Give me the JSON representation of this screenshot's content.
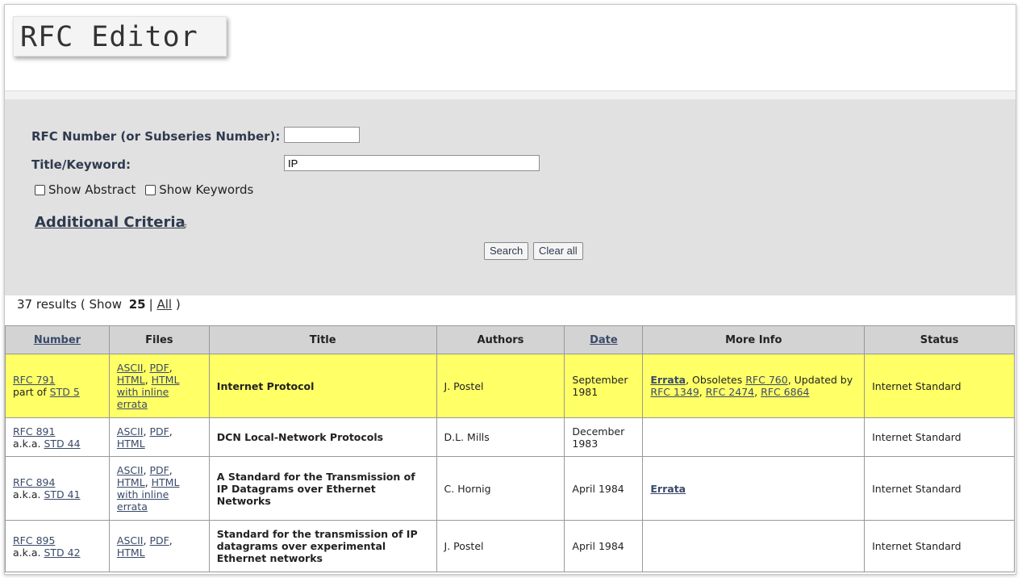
{
  "site": {
    "logo": "RFC Editor"
  },
  "search": {
    "rfc_number_label": "RFC Number (or Subseries Number):",
    "rfc_number_value": "",
    "title_label": "Title/Keyword:",
    "title_value": "IP",
    "show_abstract": "Show Abstract",
    "show_keywords": "Show Keywords",
    "additional_criteria": "Additional Criteria",
    "search_button": "Search",
    "clear_button": "Clear all"
  },
  "results": {
    "count": "37 results ( Show",
    "show_25": "25",
    "sep": "|",
    "show_all": "All",
    "close": ")"
  },
  "table": {
    "headers": [
      "Number",
      "Files",
      "Title",
      "Authors",
      "Date",
      "More Info",
      "Status"
    ],
    "rows": [
      {
        "number": "RFC 791",
        "sub_prefix": "part of",
        "sub": "STD 5",
        "files_a": "ASCII",
        "files_b": "PDF",
        "files_c": "HTML",
        "files_d": "HTML with inline errata",
        "title": "Internet Protocol",
        "authors": "J. Postel",
        "date": "September 1981",
        "more_errata": "Errata",
        "more_text1": ", Obsoletes",
        "more_link1": "RFC 760",
        "more_text2": ", Updated by",
        "more_link2": "RFC 1349",
        "more_link3": "RFC 2474",
        "more_link4": "RFC 6864",
        "status": "Internet Standard"
      },
      {
        "number": "RFC 891",
        "sub_prefix": "a.k.a.",
        "sub": "STD 44",
        "files_a": "ASCII",
        "files_b": "PDF",
        "files_c": "HTML",
        "title": "DCN Local-Network Protocols",
        "authors": "D.L. Mills",
        "date": "December 1983",
        "status": "Internet Standard"
      },
      {
        "number": "RFC 894",
        "sub_prefix": "a.k.a.",
        "sub": "STD 41",
        "files_a": "ASCII",
        "files_b": "PDF",
        "files_c": "HTML",
        "files_d": "HTML with inline errata",
        "title": "A Standard for the Transmission of IP Datagrams over Ethernet Networks",
        "authors": "C. Hornig",
        "date": "April 1984",
        "more_errata": "Errata",
        "status": "Internet Standard"
      },
      {
        "number": "RFC 895",
        "sub_prefix": "a.k.a.",
        "sub": "STD 42",
        "files_a": "ASCII",
        "files_b": "PDF",
        "files_c": "HTML",
        "title": "Standard for the transmission of IP datagrams over experimental Ethernet networks",
        "authors": "J. Postel",
        "date": "April 1984",
        "status": "Internet Standard"
      }
    ]
  }
}
